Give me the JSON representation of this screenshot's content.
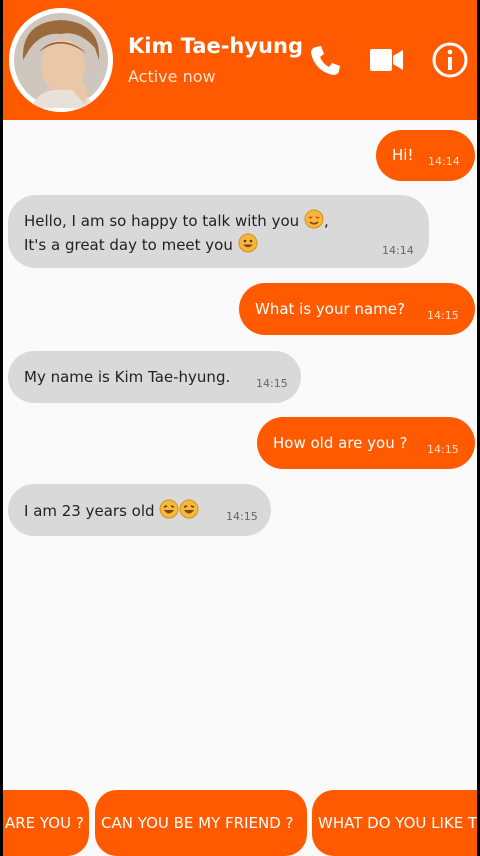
{
  "header": {
    "contact_name": "Kim Tae-hyung",
    "status": "Active now",
    "icons": [
      "phone-icon",
      "video-camera-icon",
      "info-icon"
    ]
  },
  "colors": {
    "accent": "#ff5a00",
    "incoming": "#d9d9d9",
    "background": "#fafafa"
  },
  "messages": [
    {
      "direction": "out",
      "lines": [
        "Hi!"
      ],
      "time": "14:14"
    },
    {
      "direction": "in",
      "lines": [
        "Hello, I am so happy to talk with you",
        "It's a great day to meet you"
      ],
      "time": "14:14"
    },
    {
      "direction": "out",
      "lines": [
        "What is your name?"
      ],
      "time": "14:15"
    },
    {
      "direction": "in",
      "lines": [
        "My name is Kim Tae-hyung."
      ],
      "time": "14:15"
    },
    {
      "direction": "out",
      "lines": [
        "How old are you ?"
      ],
      "time": "14:15"
    },
    {
      "direction": "in",
      "lines": [
        "I am 23 years old"
      ],
      "time": "14:15"
    }
  ],
  "quick_replies": [
    "ARE YOU ?",
    "CAN YOU BE MY FRIEND ?",
    "WHAT DO YOU LIKE T"
  ]
}
